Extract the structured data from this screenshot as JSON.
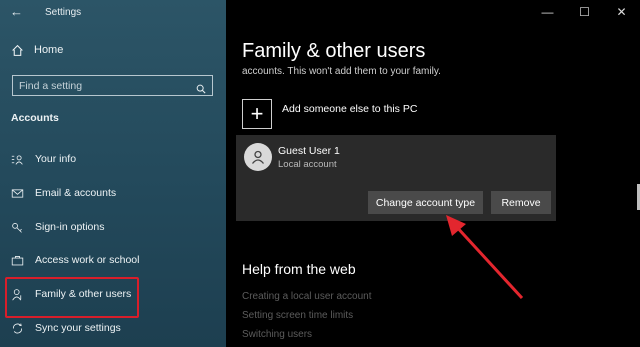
{
  "window": {
    "title": "Settings",
    "controls": {
      "minimize": "—",
      "maximize": "☐",
      "close": "✕"
    }
  },
  "sidebar": {
    "home_label": "Home",
    "search_placeholder": "Find a setting",
    "section_title": "Accounts",
    "items": [
      {
        "label": "Your info",
        "icon": "person-card-icon"
      },
      {
        "label": "Email & accounts",
        "icon": "mail-icon"
      },
      {
        "label": "Sign-in options",
        "icon": "key-icon"
      },
      {
        "label": "Access work or school",
        "icon": "briefcase-icon"
      },
      {
        "label": "Family & other users",
        "icon": "person-add-icon",
        "selected": true
      },
      {
        "label": "Sync your settings",
        "icon": "sync-icon"
      }
    ]
  },
  "main": {
    "title": "Family & other users",
    "cut_text": "accounts. This won't add them to your family.",
    "add_label": "Add someone else to this PC",
    "user": {
      "name": "Guest User 1",
      "type": "Local account"
    },
    "buttons": {
      "change": "Change account type",
      "remove": "Remove"
    },
    "help": {
      "title": "Help from the web",
      "links": [
        "Creating a local user account",
        "Setting screen time limits",
        "Switching users"
      ]
    }
  },
  "colors": {
    "sidebar_bg": "#23495b",
    "highlight": "#d81e2a",
    "annotation_arrow": "#e3262e",
    "button_bg": "#4a4a4a"
  }
}
